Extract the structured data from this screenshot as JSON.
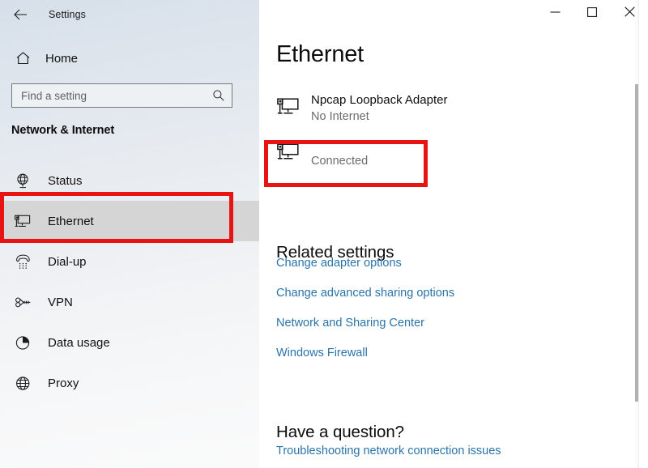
{
  "window": {
    "app_title": "Settings",
    "back_icon": "back-arrow-icon",
    "controls": {
      "minimize": "minimize-icon",
      "maximize": "maximize-icon",
      "close": "close-icon"
    }
  },
  "sidebar": {
    "home": {
      "label": "Home",
      "icon": "home-icon"
    },
    "search": {
      "placeholder": "Find a setting",
      "value": "",
      "icon": "search-icon"
    },
    "category_title": "Network & Internet",
    "items": [
      {
        "label": "Status",
        "icon": "network-status-globe-icon",
        "selected": false
      },
      {
        "label": "Ethernet",
        "icon": "ethernet-monitor-icon",
        "selected": true
      },
      {
        "label": "Dial-up",
        "icon": "dialup-phone-icon",
        "selected": false
      },
      {
        "label": "VPN",
        "icon": "vpn-icon",
        "selected": false
      },
      {
        "label": "Data usage",
        "icon": "pie-chart-icon",
        "selected": false
      },
      {
        "label": "Proxy",
        "icon": "globe-icon",
        "selected": false
      }
    ]
  },
  "main": {
    "page_title": "Ethernet",
    "adapters": [
      {
        "name": "Npcap Loopback Adapter",
        "status": "No Internet",
        "icon": "ethernet-adapter-icon"
      },
      {
        "name": "",
        "status": "Connected",
        "icon": "ethernet-adapter-icon"
      }
    ],
    "related_settings": {
      "heading": "Related settings",
      "links": [
        "Change adapter options",
        "Change advanced sharing options",
        "Network and Sharing Center",
        "Windows Firewall"
      ]
    },
    "have_a_question": {
      "heading": "Have a question?",
      "links": [
        "Troubleshooting network connection issues"
      ]
    }
  },
  "annotations": {
    "highlight_color": "#e81313",
    "boxes": [
      {
        "target": "sidebar-item-ethernet"
      },
      {
        "target": "adapter-connected"
      }
    ]
  },
  "colors": {
    "link": "#2a73ab",
    "selected_nav_bg": "#d5d5d5",
    "sidebar_top": "#d6e0ea",
    "sidebar_bottom": "#fafafa"
  }
}
